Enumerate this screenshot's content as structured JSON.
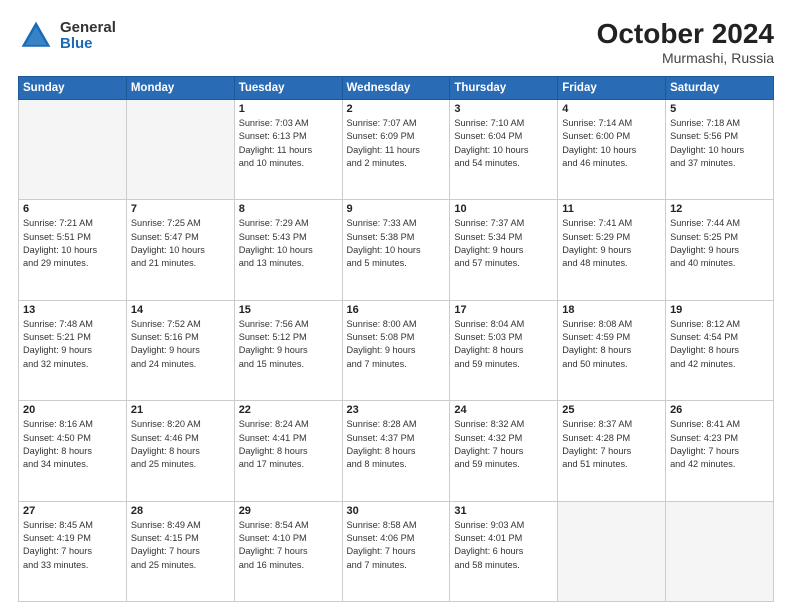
{
  "logo": {
    "general": "General",
    "blue": "Blue"
  },
  "title": "October 2024",
  "location": "Murmashi, Russia",
  "days_of_week": [
    "Sunday",
    "Monday",
    "Tuesday",
    "Wednesday",
    "Thursday",
    "Friday",
    "Saturday"
  ],
  "weeks": [
    [
      {
        "day": "",
        "info": ""
      },
      {
        "day": "",
        "info": ""
      },
      {
        "day": "1",
        "info": "Sunrise: 7:03 AM\nSunset: 6:13 PM\nDaylight: 11 hours\nand 10 minutes."
      },
      {
        "day": "2",
        "info": "Sunrise: 7:07 AM\nSunset: 6:09 PM\nDaylight: 11 hours\nand 2 minutes."
      },
      {
        "day": "3",
        "info": "Sunrise: 7:10 AM\nSunset: 6:04 PM\nDaylight: 10 hours\nand 54 minutes."
      },
      {
        "day": "4",
        "info": "Sunrise: 7:14 AM\nSunset: 6:00 PM\nDaylight: 10 hours\nand 46 minutes."
      },
      {
        "day": "5",
        "info": "Sunrise: 7:18 AM\nSunset: 5:56 PM\nDaylight: 10 hours\nand 37 minutes."
      }
    ],
    [
      {
        "day": "6",
        "info": "Sunrise: 7:21 AM\nSunset: 5:51 PM\nDaylight: 10 hours\nand 29 minutes."
      },
      {
        "day": "7",
        "info": "Sunrise: 7:25 AM\nSunset: 5:47 PM\nDaylight: 10 hours\nand 21 minutes."
      },
      {
        "day": "8",
        "info": "Sunrise: 7:29 AM\nSunset: 5:43 PM\nDaylight: 10 hours\nand 13 minutes."
      },
      {
        "day": "9",
        "info": "Sunrise: 7:33 AM\nSunset: 5:38 PM\nDaylight: 10 hours\nand 5 minutes."
      },
      {
        "day": "10",
        "info": "Sunrise: 7:37 AM\nSunset: 5:34 PM\nDaylight: 9 hours\nand 57 minutes."
      },
      {
        "day": "11",
        "info": "Sunrise: 7:41 AM\nSunset: 5:29 PM\nDaylight: 9 hours\nand 48 minutes."
      },
      {
        "day": "12",
        "info": "Sunrise: 7:44 AM\nSunset: 5:25 PM\nDaylight: 9 hours\nand 40 minutes."
      }
    ],
    [
      {
        "day": "13",
        "info": "Sunrise: 7:48 AM\nSunset: 5:21 PM\nDaylight: 9 hours\nand 32 minutes."
      },
      {
        "day": "14",
        "info": "Sunrise: 7:52 AM\nSunset: 5:16 PM\nDaylight: 9 hours\nand 24 minutes."
      },
      {
        "day": "15",
        "info": "Sunrise: 7:56 AM\nSunset: 5:12 PM\nDaylight: 9 hours\nand 15 minutes."
      },
      {
        "day": "16",
        "info": "Sunrise: 8:00 AM\nSunset: 5:08 PM\nDaylight: 9 hours\nand 7 minutes."
      },
      {
        "day": "17",
        "info": "Sunrise: 8:04 AM\nSunset: 5:03 PM\nDaylight: 8 hours\nand 59 minutes."
      },
      {
        "day": "18",
        "info": "Sunrise: 8:08 AM\nSunset: 4:59 PM\nDaylight: 8 hours\nand 50 minutes."
      },
      {
        "day": "19",
        "info": "Sunrise: 8:12 AM\nSunset: 4:54 PM\nDaylight: 8 hours\nand 42 minutes."
      }
    ],
    [
      {
        "day": "20",
        "info": "Sunrise: 8:16 AM\nSunset: 4:50 PM\nDaylight: 8 hours\nand 34 minutes."
      },
      {
        "day": "21",
        "info": "Sunrise: 8:20 AM\nSunset: 4:46 PM\nDaylight: 8 hours\nand 25 minutes."
      },
      {
        "day": "22",
        "info": "Sunrise: 8:24 AM\nSunset: 4:41 PM\nDaylight: 8 hours\nand 17 minutes."
      },
      {
        "day": "23",
        "info": "Sunrise: 8:28 AM\nSunset: 4:37 PM\nDaylight: 8 hours\nand 8 minutes."
      },
      {
        "day": "24",
        "info": "Sunrise: 8:32 AM\nSunset: 4:32 PM\nDaylight: 7 hours\nand 59 minutes."
      },
      {
        "day": "25",
        "info": "Sunrise: 8:37 AM\nSunset: 4:28 PM\nDaylight: 7 hours\nand 51 minutes."
      },
      {
        "day": "26",
        "info": "Sunrise: 8:41 AM\nSunset: 4:23 PM\nDaylight: 7 hours\nand 42 minutes."
      }
    ],
    [
      {
        "day": "27",
        "info": "Sunrise: 8:45 AM\nSunset: 4:19 PM\nDaylight: 7 hours\nand 33 minutes."
      },
      {
        "day": "28",
        "info": "Sunrise: 8:49 AM\nSunset: 4:15 PM\nDaylight: 7 hours\nand 25 minutes."
      },
      {
        "day": "29",
        "info": "Sunrise: 8:54 AM\nSunset: 4:10 PM\nDaylight: 7 hours\nand 16 minutes."
      },
      {
        "day": "30",
        "info": "Sunrise: 8:58 AM\nSunset: 4:06 PM\nDaylight: 7 hours\nand 7 minutes."
      },
      {
        "day": "31",
        "info": "Sunrise: 9:03 AM\nSunset: 4:01 PM\nDaylight: 6 hours\nand 58 minutes."
      },
      {
        "day": "",
        "info": ""
      },
      {
        "day": "",
        "info": ""
      }
    ]
  ]
}
